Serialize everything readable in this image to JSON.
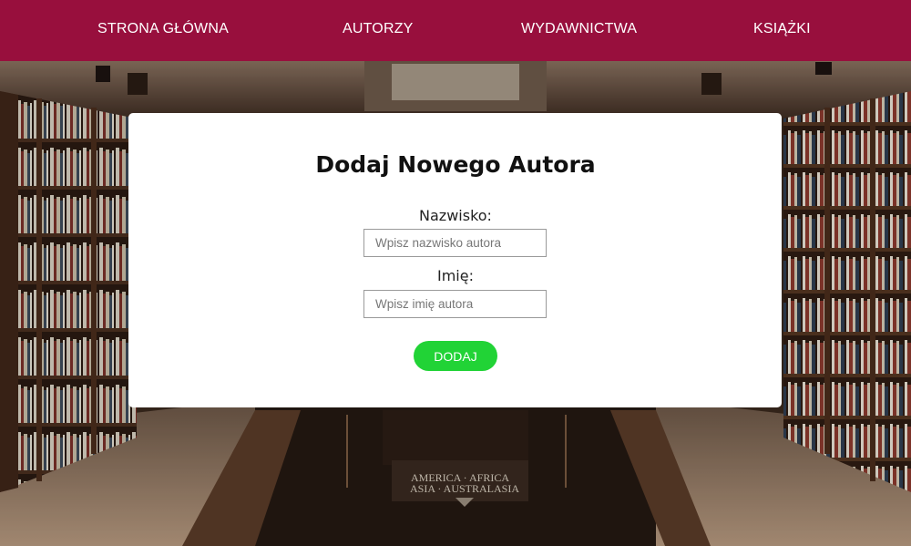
{
  "nav": {
    "items": [
      {
        "label": "STRONA GŁÓWNA"
      },
      {
        "label": "AUTORZY"
      },
      {
        "label": "WYDAWNICTWA"
      },
      {
        "label": "KSIĄŻKI"
      }
    ]
  },
  "background": {
    "sign_line1": "AMERICA · AFRICA",
    "sign_line2": "ASIA · AUSTRALASIA"
  },
  "form": {
    "title": "Dodaj Nowego Autora",
    "surname_label": "Nazwisko:",
    "surname_placeholder": "Wpisz nazwisko autora",
    "surname_value": "",
    "name_label": "Imię:",
    "name_placeholder": "Wpisz imię autora",
    "name_value": "",
    "submit_label": "DODAJ"
  },
  "colors": {
    "nav_bg": "#980f3d",
    "submit_bg": "#21d336",
    "card_bg": "#ffffff"
  }
}
